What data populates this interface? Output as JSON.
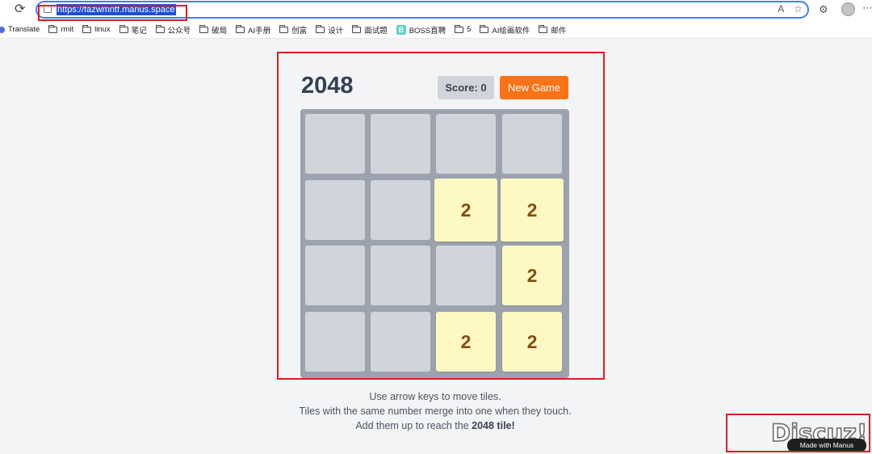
{
  "browser": {
    "url": "https://fazwmntf.manus.space",
    "bookmarks": [
      "Translate",
      "rmit",
      "linux",
      "笔记",
      "公众号",
      "破局",
      "AI手册",
      "创富",
      "设计",
      "面试题",
      "BOSS直聘",
      "5",
      "AI绘画软件",
      "邮件"
    ],
    "icons": {
      "reload": "reload-icon",
      "site": "site-info-icon",
      "read_aloud": "read-aloud-icon",
      "favorite": "star-icon",
      "extensions": "extensions-icon",
      "profile": "avatar"
    }
  },
  "game": {
    "title": "2048",
    "score_label": "Score: 0",
    "new_game_label": "New Game",
    "grid": [
      [
        null,
        null,
        null,
        null
      ],
      [
        null,
        null,
        2,
        2
      ],
      [
        null,
        null,
        null,
        2
      ],
      [
        null,
        null,
        2,
        2
      ]
    ],
    "instructions": {
      "line1": "Use arrow keys to move tiles.",
      "line2": "Tiles with the same number merge into one when they touch.",
      "line3_prefix": "Add them up to reach the ",
      "line3_bold": "2048 tile!"
    },
    "colors": {
      "accent": "#f97316",
      "board": "#9ca3af",
      "empty_cell": "#d1d5db",
      "tile_2": "#fef9c3",
      "tile_text": "#854d0e"
    }
  },
  "watermark": {
    "discuz": "Discuz!",
    "badge": "Made with Manus"
  }
}
